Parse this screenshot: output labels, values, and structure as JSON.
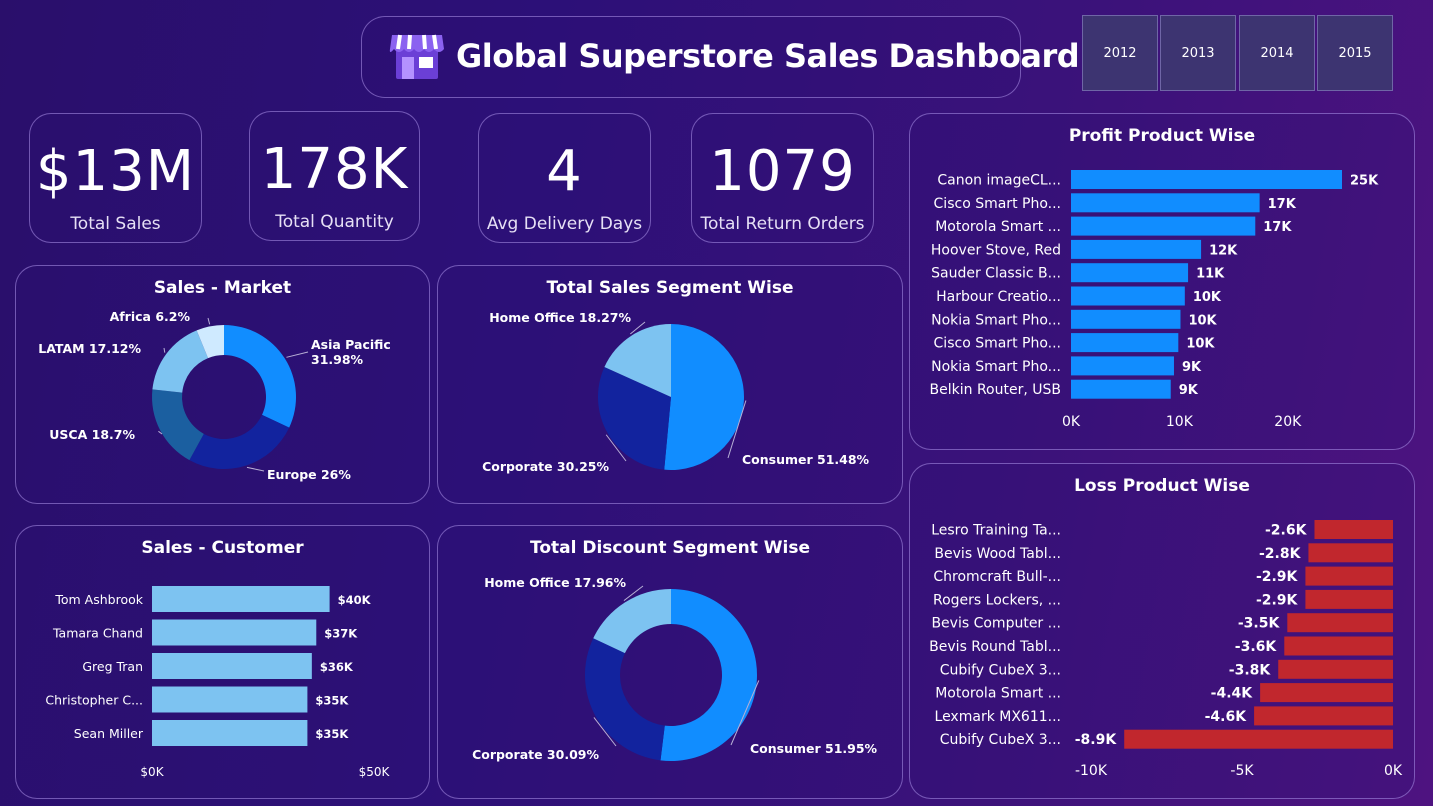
{
  "header": {
    "title": "Global Superstore Sales Dashboard"
  },
  "years": [
    "2012",
    "2013",
    "2014",
    "2015"
  ],
  "kpis": {
    "sales": {
      "value": "$13M",
      "label": "Total Sales"
    },
    "quantity": {
      "value": "178K",
      "label": "Total Quantity"
    },
    "delivery": {
      "value": "4",
      "label": "Avg Delivery Days"
    },
    "returns": {
      "value": "1079",
      "label": "Total Return Orders"
    }
  },
  "colors": {
    "accent": "#118dff",
    "dark_blue": "#12239e",
    "light_blue": "#7dc3f1",
    "pale_blue": "#cfeaff",
    "steel_blue": "#1b5fa0",
    "loss_red": "#c1272d",
    "customer_bar": "#7dc3f1"
  },
  "chart_data": [
    {
      "id": "market",
      "type": "pie",
      "title": "Sales - Market",
      "slices": [
        {
          "label": "Asia Pacific",
          "value": 31.98,
          "text": "Asia Pacific 31.98%",
          "color": "#118dff"
        },
        {
          "label": "Europe",
          "value": 26,
          "text": "Europe 26%",
          "color": "#12239e"
        },
        {
          "label": "USCA",
          "value": 18.7,
          "text": "USCA 18.7%",
          "color": "#1b5fa0"
        },
        {
          "label": "LATAM",
          "value": 17.12,
          "text": "LATAM 17.12%",
          "color": "#7dc3f1"
        },
        {
          "label": "Africa",
          "value": 6.2,
          "text": "Africa 6.2%",
          "color": "#cfeaff"
        }
      ]
    },
    {
      "id": "segment_sales",
      "type": "pie",
      "title": "Total Sales Segment Wise",
      "slices": [
        {
          "label": "Consumer",
          "value": 51.48,
          "text": "Consumer 51.48%",
          "color": "#118dff"
        },
        {
          "label": "Corporate",
          "value": 30.25,
          "text": "Corporate 30.25%",
          "color": "#12239e"
        },
        {
          "label": "Home Office",
          "value": 18.27,
          "text": "Home Office 18.27%",
          "color": "#7dc3f1"
        }
      ]
    },
    {
      "id": "segment_discount",
      "type": "pie",
      "title": "Total Discount Segment Wise",
      "slices": [
        {
          "label": "Consumer",
          "value": 51.95,
          "text": "Consumer 51.95%",
          "color": "#118dff"
        },
        {
          "label": "Corporate",
          "value": 30.09,
          "text": "Corporate 30.09%",
          "color": "#12239e"
        },
        {
          "label": "Home Office",
          "value": 17.96,
          "text": "Home Office 17.96%",
          "color": "#7dc3f1"
        }
      ]
    },
    {
      "id": "customer",
      "type": "bar",
      "title": "Sales - Customer",
      "categories": [
        "Tom Ashbrook",
        "Tamara Chand",
        "Greg Tran",
        "Christopher C...",
        "Sean Miller"
      ],
      "values": [
        40000,
        37000,
        36000,
        35000,
        35000
      ],
      "labels": [
        "$40K",
        "$37K",
        "$36K",
        "$35K",
        "$35K"
      ],
      "xlim": [
        0,
        50000
      ],
      "ticks": [
        "$0K",
        "$50K"
      ]
    },
    {
      "id": "profit",
      "type": "bar",
      "title": "Profit Product Wise",
      "categories": [
        "Canon imageCL...",
        "Cisco Smart Pho...",
        "Motorola Smart ...",
        "Hoover Stove, Red",
        "Sauder Classic B...",
        "Harbour Creatio...",
        "Nokia Smart Pho...",
        "Cisco Smart Pho...",
        "Nokia Smart Pho...",
        "Belkin Router, USB"
      ],
      "values": [
        25000,
        17400,
        17000,
        12000,
        10800,
        10500,
        10100,
        9900,
        9500,
        9200
      ],
      "labels": [
        "25K",
        "17K",
        "17K",
        "12K",
        "11K",
        "10K",
        "10K",
        "10K",
        "9K",
        "9K"
      ],
      "xlim": [
        0,
        25000
      ],
      "ticks": [
        "0K",
        "10K",
        "20K"
      ],
      "tick_values": [
        0,
        10000,
        20000
      ]
    },
    {
      "id": "loss",
      "type": "bar",
      "title": "Loss Product Wise",
      "categories": [
        "Lesro Training Ta...",
        "Bevis Wood Tabl...",
        "Chromcraft Bull-...",
        "Rogers Lockers, ...",
        "Bevis Computer ...",
        "Bevis Round Tabl...",
        "Cubify CubeX 3...",
        "Motorola Smart ...",
        "Lexmark MX611...",
        "Cubify CubeX 3..."
      ],
      "values": [
        -2600,
        -2800,
        -2900,
        -2900,
        -3500,
        -3600,
        -3800,
        -4400,
        -4600,
        -8900
      ],
      "labels": [
        "-2.6K",
        "-2.8K",
        "-2.9K",
        "-2.9K",
        "-3.5K",
        "-3.6K",
        "-3.8K",
        "-4.4K",
        "-4.6K",
        "-8.9K"
      ],
      "xlim": [
        -10000,
        0
      ],
      "ticks": [
        "-10K",
        "-5K",
        "0K"
      ],
      "tick_values": [
        -10000,
        -5000,
        0
      ]
    }
  ]
}
